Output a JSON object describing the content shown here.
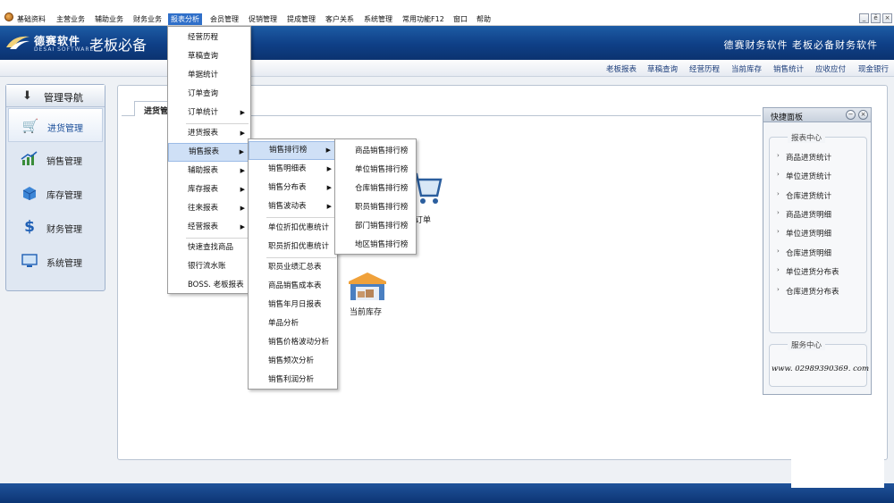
{
  "menubar": {
    "items": [
      "基础资料",
      "主营业务",
      "辅助业务",
      "财务业务",
      "报表分析",
      "会员管理",
      "促销管理",
      "提成管理",
      "客户关系",
      "系统管理",
      "常用功能F12",
      "窗口",
      "帮助"
    ],
    "active": "报表分析",
    "window_buttons": [
      "_",
      "ē",
      "×"
    ]
  },
  "banner": {
    "brand": "德赛软件",
    "brand_sub": "DESAI SOFTWARE",
    "product_title": "老板必备",
    "slogan": "德赛财务软件 老板必备财务软件",
    "colors": {
      "top": "#1d5ca5",
      "bottom": "#0b3370"
    }
  },
  "quick_links": [
    "老板报表",
    "草稿查询",
    "经营历程",
    "当前库存",
    "销售统计",
    "应收应付",
    "现金银行"
  ],
  "nav": {
    "title": "管理导航",
    "items": [
      {
        "label": "进货管理",
        "icon": "cart-icon",
        "active": true
      },
      {
        "label": "销售管理",
        "icon": "chart-icon",
        "active": false
      },
      {
        "label": "库存管理",
        "icon": "box-icon",
        "active": false
      },
      {
        "label": "财务管理",
        "icon": "dollar-icon",
        "active": false
      },
      {
        "label": "系统管理",
        "icon": "monitor-icon",
        "active": false
      }
    ]
  },
  "main": {
    "tab_label": "进货管理",
    "tiles": [
      {
        "label": "订单",
        "icon": "shopping-cart-icon"
      },
      {
        "label": "当前库存",
        "icon": "warehouse-icon"
      }
    ]
  },
  "report_menu": {
    "items": [
      "经营历程",
      "草稿查询",
      "单据统计",
      "订单查询",
      "订单统计",
      "进货报表",
      "销售报表",
      "辅助报表",
      "库存报表",
      "往来报表",
      "经营报表",
      "快速查找商品",
      "银行流水账",
      "BOSS. 老板报表"
    ],
    "highlighted": "销售报表"
  },
  "sales_report_menu": {
    "items": [
      "销售排行榜",
      "销售明细表",
      "销售分布表",
      "销售波动表",
      "单位折扣优惠统计",
      "职员折扣优惠统计",
      "职员业绩汇总表",
      "商品销售成本表",
      "销售年月日报表",
      "单品分析",
      "销售价格波动分析",
      "销售频次分析",
      "销售利润分析"
    ],
    "highlighted": "销售排行榜"
  },
  "ranking_menu": {
    "items": [
      "商品销售排行榜",
      "单位销售排行榜",
      "仓库销售排行榜",
      "职员销售排行榜",
      "部门销售排行榜",
      "地区销售排行榜"
    ]
  },
  "quick_panel": {
    "title": "快捷面板",
    "report_center_title": "报表中心",
    "reports": [
      "商品进货统计",
      "单位进货统计",
      "仓库进货统计",
      "商品进货明细",
      "单位进货明细",
      "仓库进货明细",
      "单位进货分布表",
      "仓库进货分布表"
    ],
    "service_title": "服务中心",
    "service_url": "www. 02989390369. com"
  },
  "colors": {
    "accent": "#2f6fc9",
    "menu_highlight": "#cfe0f6",
    "bottom_bar": "#0c3574"
  }
}
